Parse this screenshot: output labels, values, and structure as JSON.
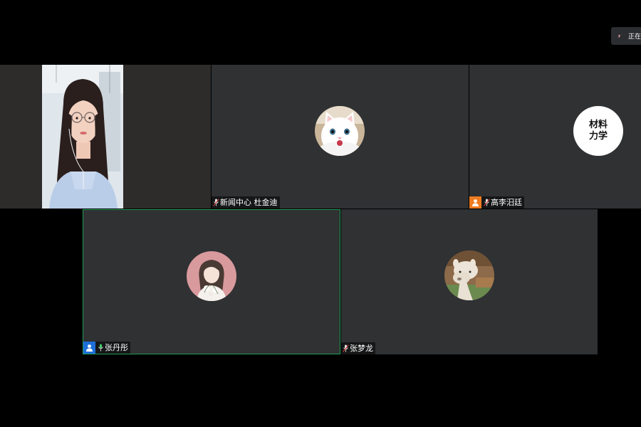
{
  "status_chip": {
    "text": "正在讲话"
  },
  "colors": {
    "background": "#000000",
    "tile": "#2f3133",
    "active_border": "#1f9c52",
    "host_badge": "#f07b1f",
    "self_badge": "#1e6fd9",
    "mic_active": "#3ed16b"
  },
  "participants": [
    {
      "name": "新闻中心 杜金迪",
      "avatar": "cat-avatar",
      "mic": "muted"
    },
    {
      "name": "高李汨廷",
      "avatar": "text-avatar",
      "avatar_text": "材料\n力学",
      "badge": "host-badge-icon",
      "mic": "muted"
    },
    {
      "name": "张丹彤",
      "avatar": "illustration-avatar",
      "badge": "self-badge-icon",
      "mic": "active"
    },
    {
      "name": "张梦龙",
      "avatar": "alpaca-avatar",
      "mic": "muted"
    }
  ]
}
